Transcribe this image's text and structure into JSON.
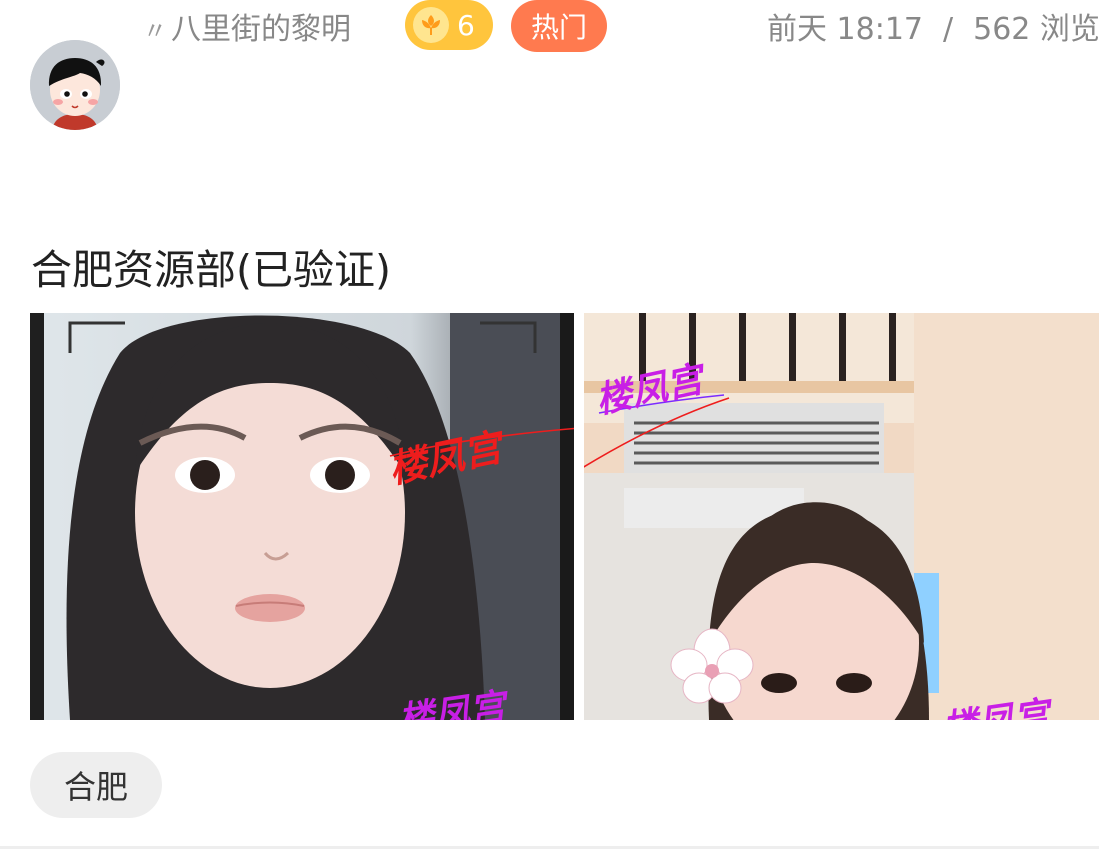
{
  "post": {
    "author": {
      "prefix_mark": "〃",
      "name": "八里街的黎明",
      "avatar_icon": "cartoon-avatar-icon"
    },
    "level_badge": {
      "icon": "flower-badge-icon",
      "value": "6",
      "color": "#ffc53d"
    },
    "hot_badge": {
      "label": "热门",
      "color": "#ff7a4f"
    },
    "time": "前天 18:17",
    "separator": "/",
    "views": "562 浏览",
    "title": "合肥资源部(已验证)",
    "images": [
      {
        "name": "photo-1",
        "watermark": "楼凤宫",
        "watermark_color": "#ee1d1d"
      },
      {
        "name": "photo-2",
        "watermark": "楼凤宫",
        "watermark_color": "#c81fe6"
      }
    ],
    "tags": [
      "合肥"
    ]
  }
}
